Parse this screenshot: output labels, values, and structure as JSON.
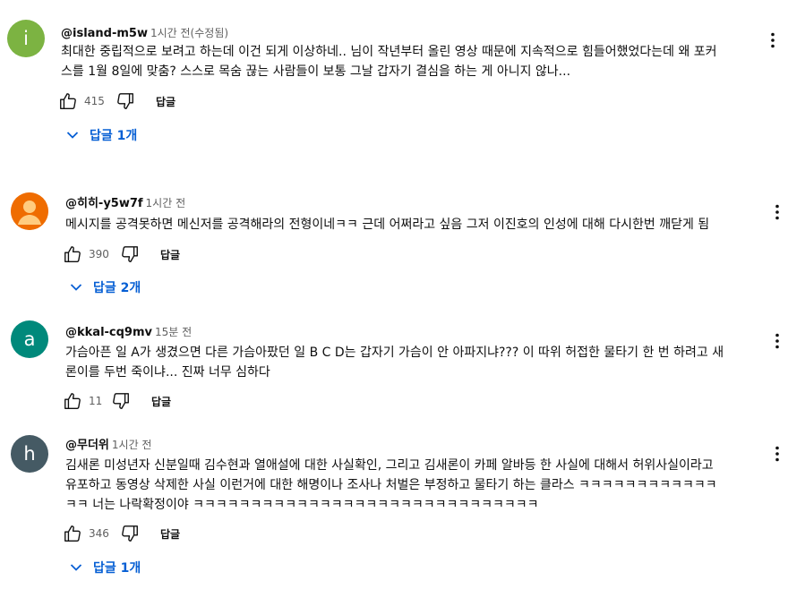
{
  "comments": [
    {
      "avatar_letter": "i",
      "avatar_color": "#7cb342",
      "author": "@island-m5w",
      "time": "1시간 전(수정됨)",
      "lines": [
        "최대한 중립적으로 보려고 하는데 이건 되게 이상하네.. 님이 작년부터 올린 영상 때문에 지속적으로 힘들어했었다는데 왜 포커",
        "스를 1월 8일에 맞춤? 스스로 목숨 끊는 사람들이 보통 그날 갑자기 결심을 하는 게 아니지 않나..."
      ],
      "likes": "415",
      "reply_label": "답글",
      "replies_label": "답글 1개"
    },
    {
      "avatar_letter": "",
      "avatar_color": "#ef6c00",
      "author": "@히히-y5w7f",
      "time": "1시간 전",
      "lines": [
        "메시지를 공격못하면 메신저를 공격해라의 전형이네ㅋㅋ 근데 어쩌라고 싶음 그저 이진호의 인성에 대해 다시한번 깨닫게 됨"
      ],
      "likes": "390",
      "reply_label": "답글",
      "replies_label": "답글 2개"
    },
    {
      "avatar_letter": "a",
      "avatar_color": "#00897b",
      "author": "@kkal-cq9mv",
      "time": "15분 전",
      "lines": [
        "가슴아픈 일 A가 생겼으면 다른 가슴아팠던 일 B C D는 갑자기 가슴이 안 아파지냐??? 이 따위 허접한 물타기 한 번 하려고 새",
        "론이를 두번 죽이냐... 진짜 너무 심하다"
      ],
      "likes": "11",
      "reply_label": "답글",
      "replies_label": ""
    },
    {
      "avatar_letter": "h",
      "avatar_color": "#455a64",
      "author": "@무더위",
      "time": "1시간 전",
      "lines": [
        "김새론 미성년자 신분일때 김수현과 열애설에 대한 사실확인, 그리고 김새론이 카페 알바등 한 사실에 대해서 허위사실이라고",
        "유포하고 동영상 삭제한 사실 이런거에 대한 해명이나 조사나  처벌은 부정하고 물타기 하는 클라스 ㅋㅋㅋㅋㅋㅋㅋㅋㅋㅋㅋㅋ",
        "ㅋㅋ 너는 나락확정이야 ㅋㅋㅋㅋㅋㅋㅋㅋㅋㅋㅋㅋㅋㅋㅋㅋㅋㅋㅋㅋㅋㅋㅋㅋㅋㅋㅋㅋㅋㅋ"
      ],
      "likes": "346",
      "reply_label": "답글",
      "replies_label": "답글 1개"
    }
  ]
}
